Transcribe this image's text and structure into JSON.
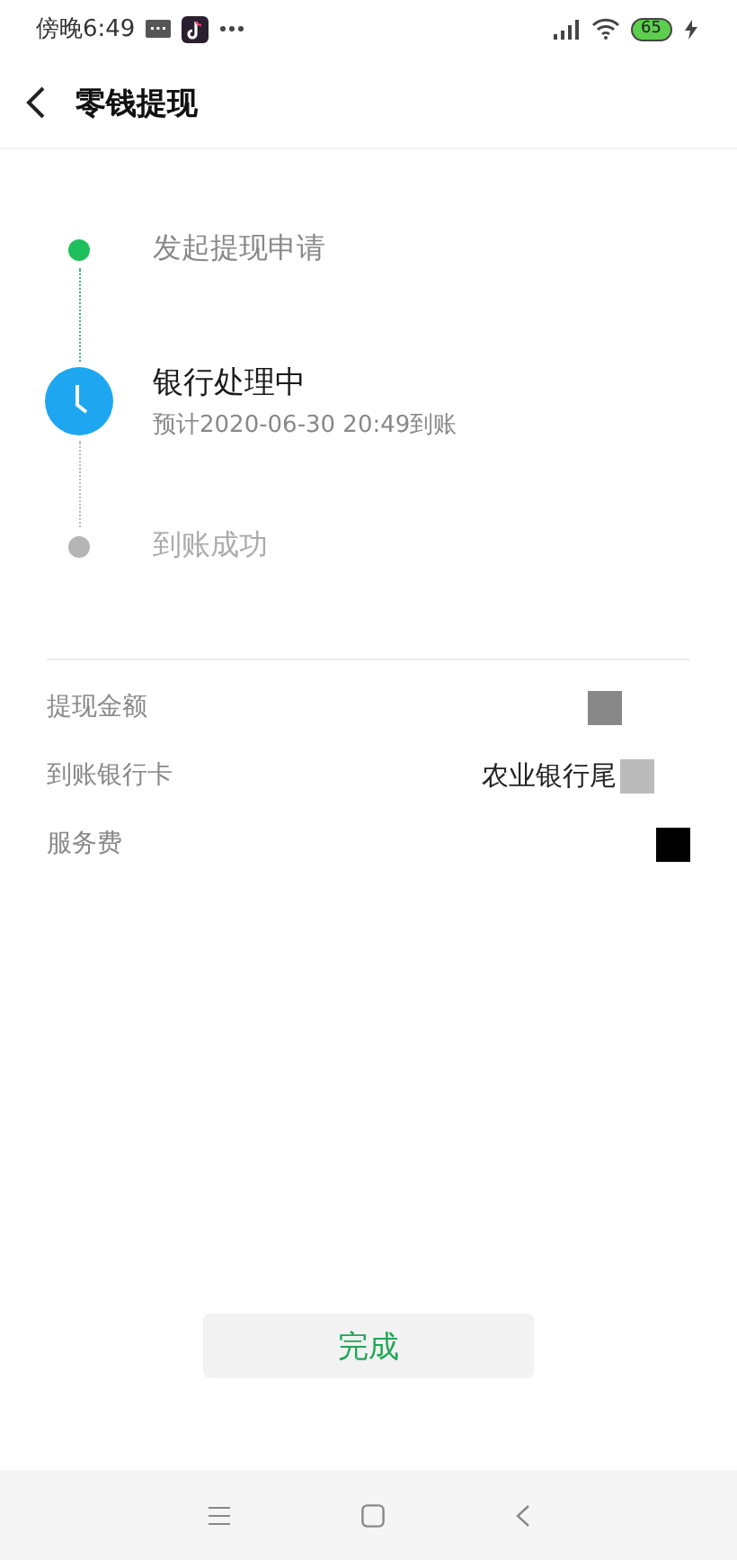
{
  "status_bar": {
    "time": "傍晚6:49",
    "battery": "65"
  },
  "header": {
    "title": "零钱提现"
  },
  "steps": [
    {
      "kind": "done",
      "label": "发起提现申请"
    },
    {
      "kind": "current",
      "label": "银行处理中",
      "detail": "预计2020-06-30 20:49到账"
    },
    {
      "kind": "pending",
      "label": "到账成功"
    }
  ],
  "details": [
    {
      "label": "提现金额",
      "color": "#888888"
    },
    {
      "label": "到账银行卡",
      "value": "农业银行尾",
      "color": "#bbbbbb"
    },
    {
      "label": "服务费",
      "color": "#000000"
    }
  ],
  "done_button": "完成"
}
